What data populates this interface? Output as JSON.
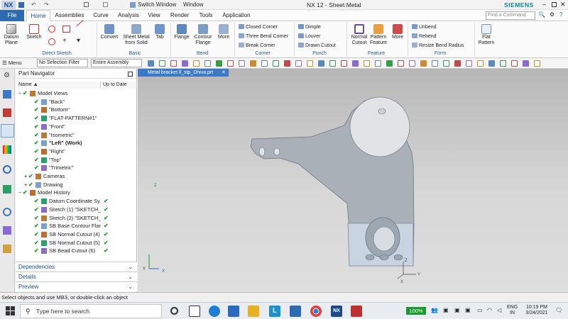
{
  "titlebar": {
    "app_badge": "NX",
    "switch_window": "Switch Window",
    "window_menu": "Window",
    "title": "NX 12 - Sheet Metal",
    "brand": "SIEMENS"
  },
  "tabs": [
    "File",
    "Home",
    "Assemblies",
    "Curve",
    "Analysis",
    "View",
    "Render",
    "Tools",
    "Application"
  ],
  "search": {
    "placeholder": "Find a Command"
  },
  "ribbon": {
    "direct_sketch": {
      "items": [
        "Datum Plane",
        "Sketch"
      ],
      "group_label": "Direct Sketch"
    },
    "basic": {
      "items": [
        "Convert",
        "Sheet Metal from Solid",
        "Tab"
      ],
      "group_label": "Basic"
    },
    "bend": {
      "items": [
        "Flange",
        "Contour Flange",
        "More"
      ],
      "group_label": "Bend"
    },
    "corner": {
      "items": [
        "Closed Corner",
        "Three Bend Corner",
        "Break Corner"
      ],
      "group_label": "Corner"
    },
    "punch": {
      "items": [
        "Dimple",
        "Louver",
        "Drawn Cutout"
      ],
      "group_label": "Punch"
    },
    "feature": {
      "items": [
        "Normal Cutout",
        "Pattern Feature",
        "More"
      ],
      "group_label": "Feature"
    },
    "form": {
      "items": [
        "Unbend",
        "Rebend",
        "Resize Bend Radius"
      ],
      "group_label": "Form"
    },
    "flat_pattern": "Flat Pattern"
  },
  "toolbar": {
    "menu": "Menu",
    "selection_filter": "No Selection Filter",
    "scope": "Entire Assembly"
  },
  "navigator": {
    "title": "Part Navigator",
    "col_name": "Name",
    "col_uptodate": "Up to Date",
    "rows": [
      {
        "text": "Model Views",
        "indent": 0,
        "bold": false,
        "check": false
      },
      {
        "text": "\"Back\"",
        "indent": 2,
        "bold": false,
        "check": false
      },
      {
        "text": "\"Bottom\"",
        "indent": 2,
        "bold": false,
        "check": false
      },
      {
        "text": "\"FLAT-PATTERN#1\"",
        "indent": 2,
        "bold": false,
        "check": false
      },
      {
        "text": "\"Front\"",
        "indent": 2,
        "bold": false,
        "check": false
      },
      {
        "text": "\"Isometric\"",
        "indent": 2,
        "bold": false,
        "check": false
      },
      {
        "text": "\"Left\" (Work)",
        "indent": 2,
        "bold": true,
        "check": false
      },
      {
        "text": "\"Right\"",
        "indent": 2,
        "bold": false,
        "check": false
      },
      {
        "text": "\"Top\"",
        "indent": 2,
        "bold": false,
        "check": false
      },
      {
        "text": "\"Trimetric\"",
        "indent": 2,
        "bold": false,
        "check": false
      },
      {
        "text": "Cameras",
        "indent": 1,
        "bold": false,
        "check": false
      },
      {
        "text": "Drawing",
        "indent": 1,
        "bold": false,
        "check": false
      },
      {
        "text": "Model History",
        "indent": 0,
        "bold": false,
        "check": false
      },
      {
        "text": "Datum Coordinate Sy...",
        "indent": 2,
        "bold": false,
        "check": true
      },
      {
        "text": "Sketch (1) \"SKETCH_0...",
        "indent": 2,
        "bold": false,
        "check": true
      },
      {
        "text": "Sketch (2) \"SKETCH_0...",
        "indent": 2,
        "bold": false,
        "check": true
      },
      {
        "text": "SB Base Contour Flan...",
        "indent": 2,
        "bold": false,
        "check": true
      },
      {
        "text": "SB Normal Cutout (4)",
        "indent": 2,
        "bold": false,
        "check": true
      },
      {
        "text": "SB Normal Cutout (5)",
        "indent": 2,
        "bold": false,
        "check": true
      },
      {
        "text": "SB Bead Cutout (6)",
        "indent": 2,
        "bold": false,
        "check": true
      }
    ],
    "panels": [
      "Dependencies",
      "Details",
      "Preview"
    ]
  },
  "document_tab": "Metal bracket ll_stp_Dhiva.prt",
  "axes": {
    "x": "X",
    "y": "Y",
    "z": "Z"
  },
  "status_message": "Select objects and use MB3, or double-click an object",
  "taskbar": {
    "search_placeholder": "Type here to search",
    "battery": "100%",
    "lang": "ENG",
    "region": "IN",
    "time": "10:19 PM",
    "date": "3/24/2021"
  },
  "colors": {
    "accent": "#3c78c8",
    "file_tab": "#2c6bb0",
    "check": "#1a9a2a",
    "viewport_top": "#b7b7b7"
  }
}
